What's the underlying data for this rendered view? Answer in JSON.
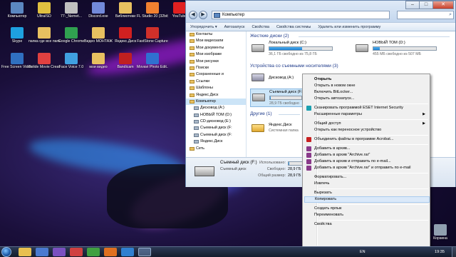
{
  "desktop": {
    "icons": [
      {
        "label": "Компьютер"
      },
      {
        "label": "UltraISO"
      },
      {
        "label": "77-_Nemet..."
      },
      {
        "label": "Discord.exe"
      },
      {
        "label": "Библиотеки"
      },
      {
        "label": "FL Studio 20 (32bit)"
      },
      {
        "label": "YouTube"
      },
      {
        "label": "Skype"
      },
      {
        "label": "папка где все папки"
      },
      {
        "label": "Google Chrome"
      },
      {
        "label": "Видео МОНТАЖ"
      },
      {
        "label": "Яндекс.Диск"
      },
      {
        "label": "FastStone Capture"
      },
      {
        "label": "Free Screen Video Re..."
      },
      {
        "label": "Bolide Movie Creator"
      },
      {
        "label": "Face Voice 7.0"
      },
      {
        "label": "мои видео"
      },
      {
        "label": "Bandicam"
      },
      {
        "label": "Movavi Photo Edit..."
      },
      {
        "label": "Корзина"
      }
    ]
  },
  "window": {
    "address": "Компьютер",
    "controls": {
      "minimize": "–",
      "maximize": "□",
      "close": "✕"
    },
    "toolbar": [
      "Упорядочить ▾",
      "Автозапуск",
      "Свойства",
      "Свойства системы",
      "Удалить или изменить программу"
    ],
    "nav": [
      {
        "label": "Контакты",
        "sub": false
      },
      {
        "label": "Мои видеозапи",
        "sub": false
      },
      {
        "label": "Мои документы",
        "sub": false
      },
      {
        "label": "Мои изображе",
        "sub": false
      },
      {
        "label": "Мои рисунки",
        "sub": false
      },
      {
        "label": "Поиски",
        "sub": false
      },
      {
        "label": "Сохраненные и",
        "sub": false
      },
      {
        "label": "Ссылки",
        "sub": false
      },
      {
        "label": "Шаблоны",
        "sub": false
      },
      {
        "label": "Яндекс.Диск",
        "sub": false
      },
      {
        "label": "Компьютер",
        "sub": false,
        "selected": true
      },
      {
        "label": "Дисковод (A:)",
        "sub": true
      },
      {
        "label": "НОВЫЙ ТОМ (D:)",
        "sub": true
      },
      {
        "label": "CD-дисковод (E:)",
        "sub": true
      },
      {
        "label": "Съемный диск (F:",
        "sub": true
      },
      {
        "label": "Съемный диск (F:",
        "sub": true
      },
      {
        "label": "Яндекс.Диск",
        "sub": true
      },
      {
        "label": "Сеть",
        "sub": false
      }
    ],
    "groups": {
      "hard": "Жесткие диски (2)",
      "removable": "Устройства со съемными носителями (3)",
      "other": "Другие (1)"
    },
    "drives": {
      "c": {
        "name": "Локальный диск (C:)",
        "free": "36,1 ГБ свободно из 75,8 ГБ",
        "used": 0.52
      },
      "d": {
        "name": "НОВЫЙ ТОМ (D:)",
        "free": "455 МБ свободно из 507 МБ",
        "used": 0.1
      },
      "a": {
        "name": "Дисковод (A:)"
      },
      "f": {
        "name": "Съемный диск (F:)",
        "free": "28,9 ГБ свободно",
        "used": 0.02
      },
      "y": {
        "name": "Яндекс.Диск",
        "free": "Системная папка"
      }
    },
    "details": {
      "name": "Съемный диск (F:)",
      "type": "Съемный диск",
      "used_label": "Использовано:",
      "free_label": "Свободно:",
      "free_value": "28,9 ГБ",
      "total_label": "Общий размер:",
      "total_value": "28,9 ГБ",
      "used": 0.02
    }
  },
  "context_menu": {
    "items": [
      {
        "label": "Открыть",
        "bold": true
      },
      {
        "label": "Открыть в новом окне"
      },
      {
        "label": "Включить BitLocker..."
      },
      {
        "label": "Открыть автозапуск..."
      },
      {
        "sep": true
      },
      {
        "label": "Сканировать программой ESET Internet Security",
        "icon": "eset-icon"
      },
      {
        "label": "Расширенные параметры",
        "arrow": true
      },
      {
        "sep": true
      },
      {
        "label": "Общий доступ",
        "arrow": true
      },
      {
        "label": "Открыть как переносное устройство"
      },
      {
        "sep": true
      },
      {
        "label": "Объединить файлы в программе Acrobat...",
        "icon": "acrobat-icon"
      },
      {
        "sep": true
      },
      {
        "label": "Добавить в архив...",
        "icon": "winrar-icon"
      },
      {
        "label": "Добавить в архив \"Archive.rar\"",
        "icon": "winrar-icon"
      },
      {
        "label": "Добавить в архив и отправить по e-mail...",
        "icon": "winrar-icon"
      },
      {
        "label": "Добавить в архив \"Archive.rar\" и отправить по e-mail",
        "icon": "winrar-icon"
      },
      {
        "sep": true
      },
      {
        "label": "Форматировать..."
      },
      {
        "label": "Извлечь"
      },
      {
        "sep": true
      },
      {
        "label": "Вырезать"
      },
      {
        "label": "Копировать",
        "highlight": true
      },
      {
        "sep": true
      },
      {
        "label": "Создать ярлык"
      },
      {
        "label": "Переименовать"
      },
      {
        "sep": true
      },
      {
        "label": "Свойства"
      }
    ]
  },
  "taskbar": {
    "lang": "EN",
    "time": "19:35"
  },
  "colors": {
    "accent": "#1f7fd0",
    "menu_highlight": "#dbe9f9",
    "group_header": "#1e3a8a"
  }
}
